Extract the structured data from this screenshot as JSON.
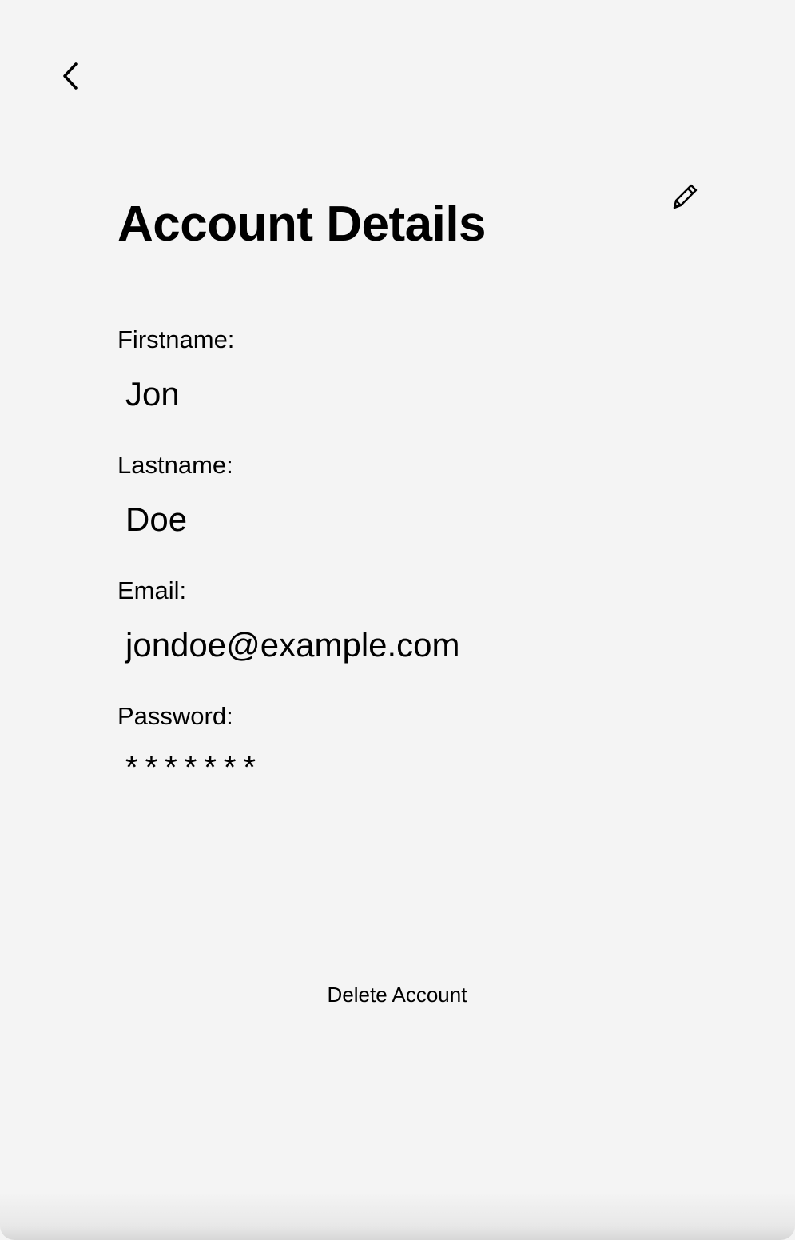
{
  "header": {
    "back_icon": "chevron-left-icon",
    "edit_icon": "pencil-icon",
    "title": "Account Details"
  },
  "fields": {
    "firstname": {
      "label": "Firstname:",
      "value": "Jon"
    },
    "lastname": {
      "label": "Lastname:",
      "value": "Doe"
    },
    "email": {
      "label": "Email:",
      "value": "jondoe@example.com"
    },
    "password": {
      "label": "Password:",
      "value": "*******"
    }
  },
  "actions": {
    "delete_label": "Delete Account"
  },
  "colors": {
    "background": "#f4f4f4",
    "text": "#000000"
  }
}
